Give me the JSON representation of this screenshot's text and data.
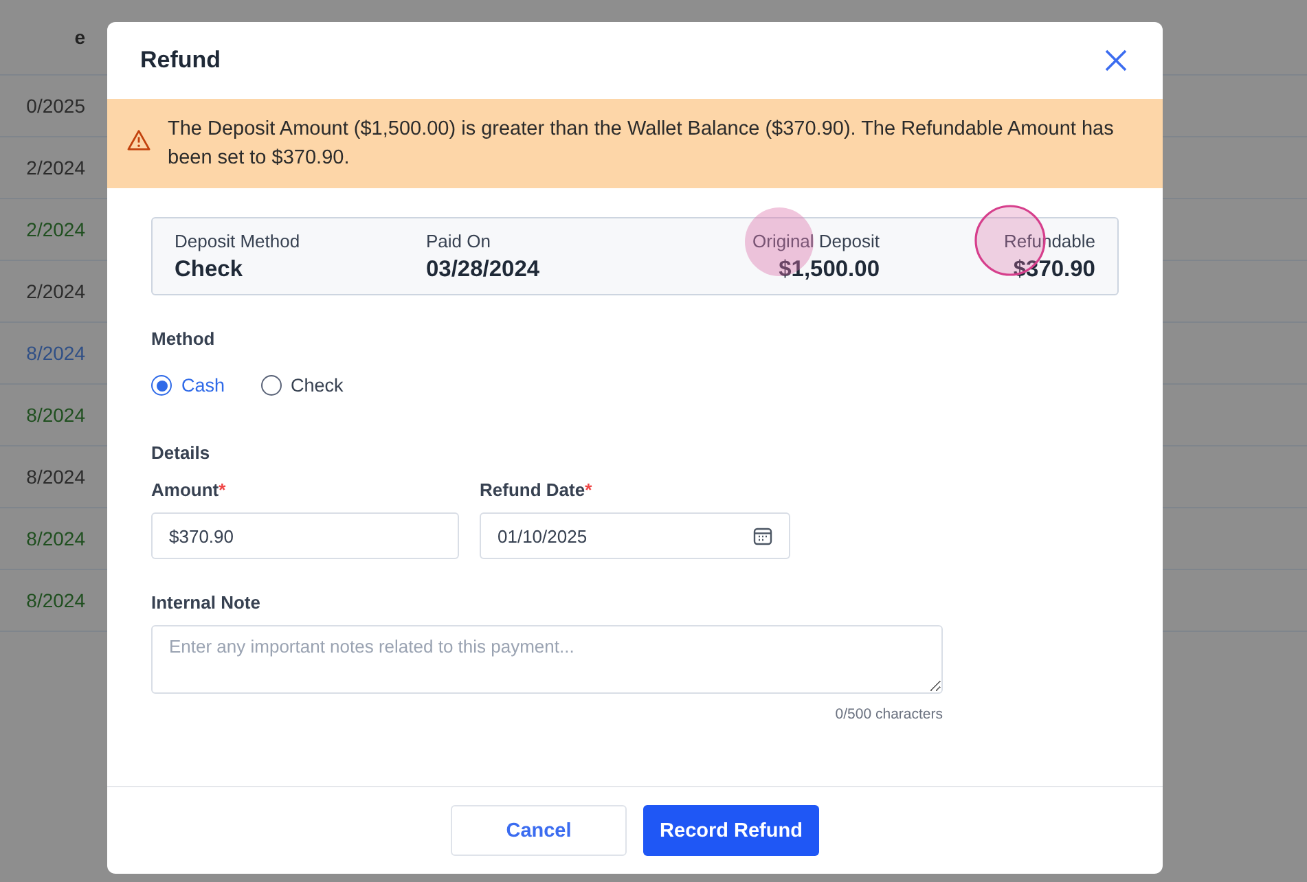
{
  "background_table": {
    "columns": [
      "e"
    ],
    "rows": [
      {
        "column_1": "0/2025",
        "color": "#2b2b2b"
      },
      {
        "column_1": "2/2024",
        "color": "#2b2b2b"
      },
      {
        "column_1": "2/2024",
        "color": "#1f4f1f"
      },
      {
        "column_1": "2/2024",
        "color": "#2b2b2b"
      },
      {
        "column_1": "8/2024",
        "color": "#2f4f86"
      },
      {
        "column_1": "8/2024",
        "color": "#1f4f1f"
      },
      {
        "column_1": "8/2024",
        "color": "#2b2b2b"
      },
      {
        "column_1": "8/2024",
        "color": "#1f4f1f"
      },
      {
        "column_1": "8/2024",
        "color": "#1f4f1f"
      }
    ]
  },
  "dialog": {
    "title": "Refund",
    "alert": "The Deposit Amount ($1,500.00) is greater than the Wallet Balance ($370.90). The Refundable Amount has been set to $370.90.",
    "summary": [
      {
        "label": "Deposit Method",
        "value": "Check"
      },
      {
        "label": "Paid On",
        "value": "03/28/2024"
      },
      {
        "label": "Original Deposit",
        "value": "$1,500.00"
      },
      {
        "label": "Refundable",
        "value": "$370.90"
      }
    ],
    "method": {
      "label": "Method",
      "options": [
        {
          "label": "Cash",
          "selected": true
        },
        {
          "label": "Check",
          "selected": false
        }
      ]
    },
    "details": {
      "heading": "Details",
      "amount": {
        "label": "Amount",
        "required_mark": "*",
        "value": "$370.90"
      },
      "refund_date": {
        "label": "Refund Date",
        "required_mark": "*",
        "value": "01/10/2025"
      }
    },
    "note": {
      "label": "Internal Note",
      "placeholder": "Enter any important notes related to this payment...",
      "counter": "0/500 characters"
    },
    "buttons": {
      "cancel": "Cancel",
      "submit": "Record Refund"
    }
  }
}
